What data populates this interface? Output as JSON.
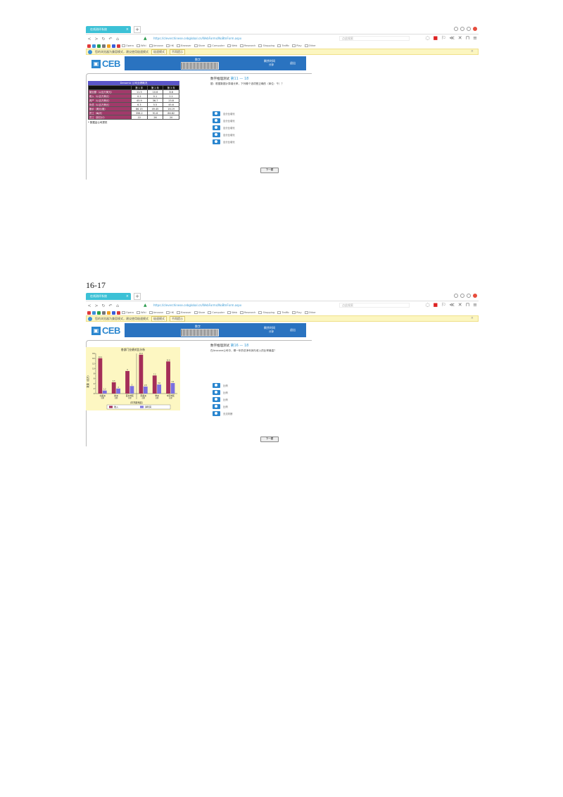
{
  "page_label": "16-17",
  "browser": {
    "tab_title": "在线测评系统",
    "tab_close": "×",
    "tab_new": "+",
    "nav": [
      "<",
      ">",
      "↻",
      "↶",
      "⌂"
    ],
    "url": "https://cleverchinese.cebglobal.cn/WebForms/NoBtnForm.aspx",
    "search_placeholder": "点此搜索",
    "bookmarks": [
      "Opera",
      "Wiki",
      "Amazon",
      "HK",
      "Browser",
      "Store",
      "Computer",
      "Web",
      "Research",
      "Shopping",
      "Traffic",
      "Play",
      "Other"
    ],
    "notify_text": "您的浏览器为兼容模式，建议使用极速模式",
    "notify_btn1": "极速模式",
    "notify_btn2": "不再提示"
  },
  "app": {
    "logo": "CEB",
    "header_title": "数字",
    "header_r1": "剩余时间",
    "header_r2": "分钟",
    "header_r3": "退出",
    "next_label": "下一题"
  },
  "q1": {
    "number_label": "数字推理测试",
    "number": "第11 — 18",
    "question": "据：根据数据计算增长率，下列哪个选项是正确的（单位：千）？",
    "table_title": "Denomic 公司业绩概况",
    "columns": [
      "",
      "第 1 年",
      "第 2 年",
      "第 3 年"
    ],
    "rows": [
      [
        "营业额（以百万美元）",
        "11.5",
        "10.6",
        "8.8"
      ],
      [
        "收入（以百万美元）",
        "0.2",
        "0.1",
        "1.1"
      ],
      [
        "资产（以百万美元）",
        "45.9",
        "36.7",
        "23.8"
      ],
      [
        "负债（以百万美元）",
        "6.3",
        "5.5",
        "45.6"
      ],
      [
        "股价（美元/股）",
        "86.15",
        "49.45",
        "16.19"
      ],
      [
        "员工（每天）",
        "396.2",
        "91.6",
        "86.82"
      ],
      [
        "员工（按日计）",
        "22",
        "26",
        "20"
      ]
    ],
    "note": "* 数据由公司提供",
    "options": [
      "百分比增长",
      "百分比增长",
      "百分比增长",
      "百分比增长",
      "百分比增长"
    ]
  },
  "q2": {
    "number_label": "数字推理测试",
    "number": "第16 — 18",
    "question": "在Arocone公司中，哪一年的总净利润与收入的比率最高？",
    "options": [
      "比例",
      "比例",
      "比例",
      "比例",
      "无法判断"
    ]
  },
  "chart_data": {
    "type": "bar",
    "title": "各部门业绩对比分析",
    "xlabel": "（中东欧地区）",
    "ylabel": "数量（百万）",
    "ylim": [
      0,
      16
    ],
    "yticks": [
      0,
      2,
      4,
      6,
      8,
      10,
      12,
      14,
      16
    ],
    "categories": [
      "北美洲",
      "欧洲",
      "亚太地区",
      "南美洲",
      "非洲",
      "中东地区"
    ],
    "categories_sub": [
      "总额",
      "总额",
      "总额",
      "总额",
      "总额",
      "总额"
    ],
    "group_divider_after": 2,
    "series": [
      {
        "name": "收入",
        "color": "#a42e58",
        "values": [
          14.1,
          4.5,
          9.0,
          15.5,
          7.2,
          12.8
        ]
      },
      {
        "name": "净利润",
        "color": "#7b6fe0",
        "values": [
          1.2,
          2.0,
          3.0,
          2.8,
          3.6,
          4.2
        ]
      }
    ],
    "legend_position": "bottom",
    "background": "#fdf7c2"
  }
}
